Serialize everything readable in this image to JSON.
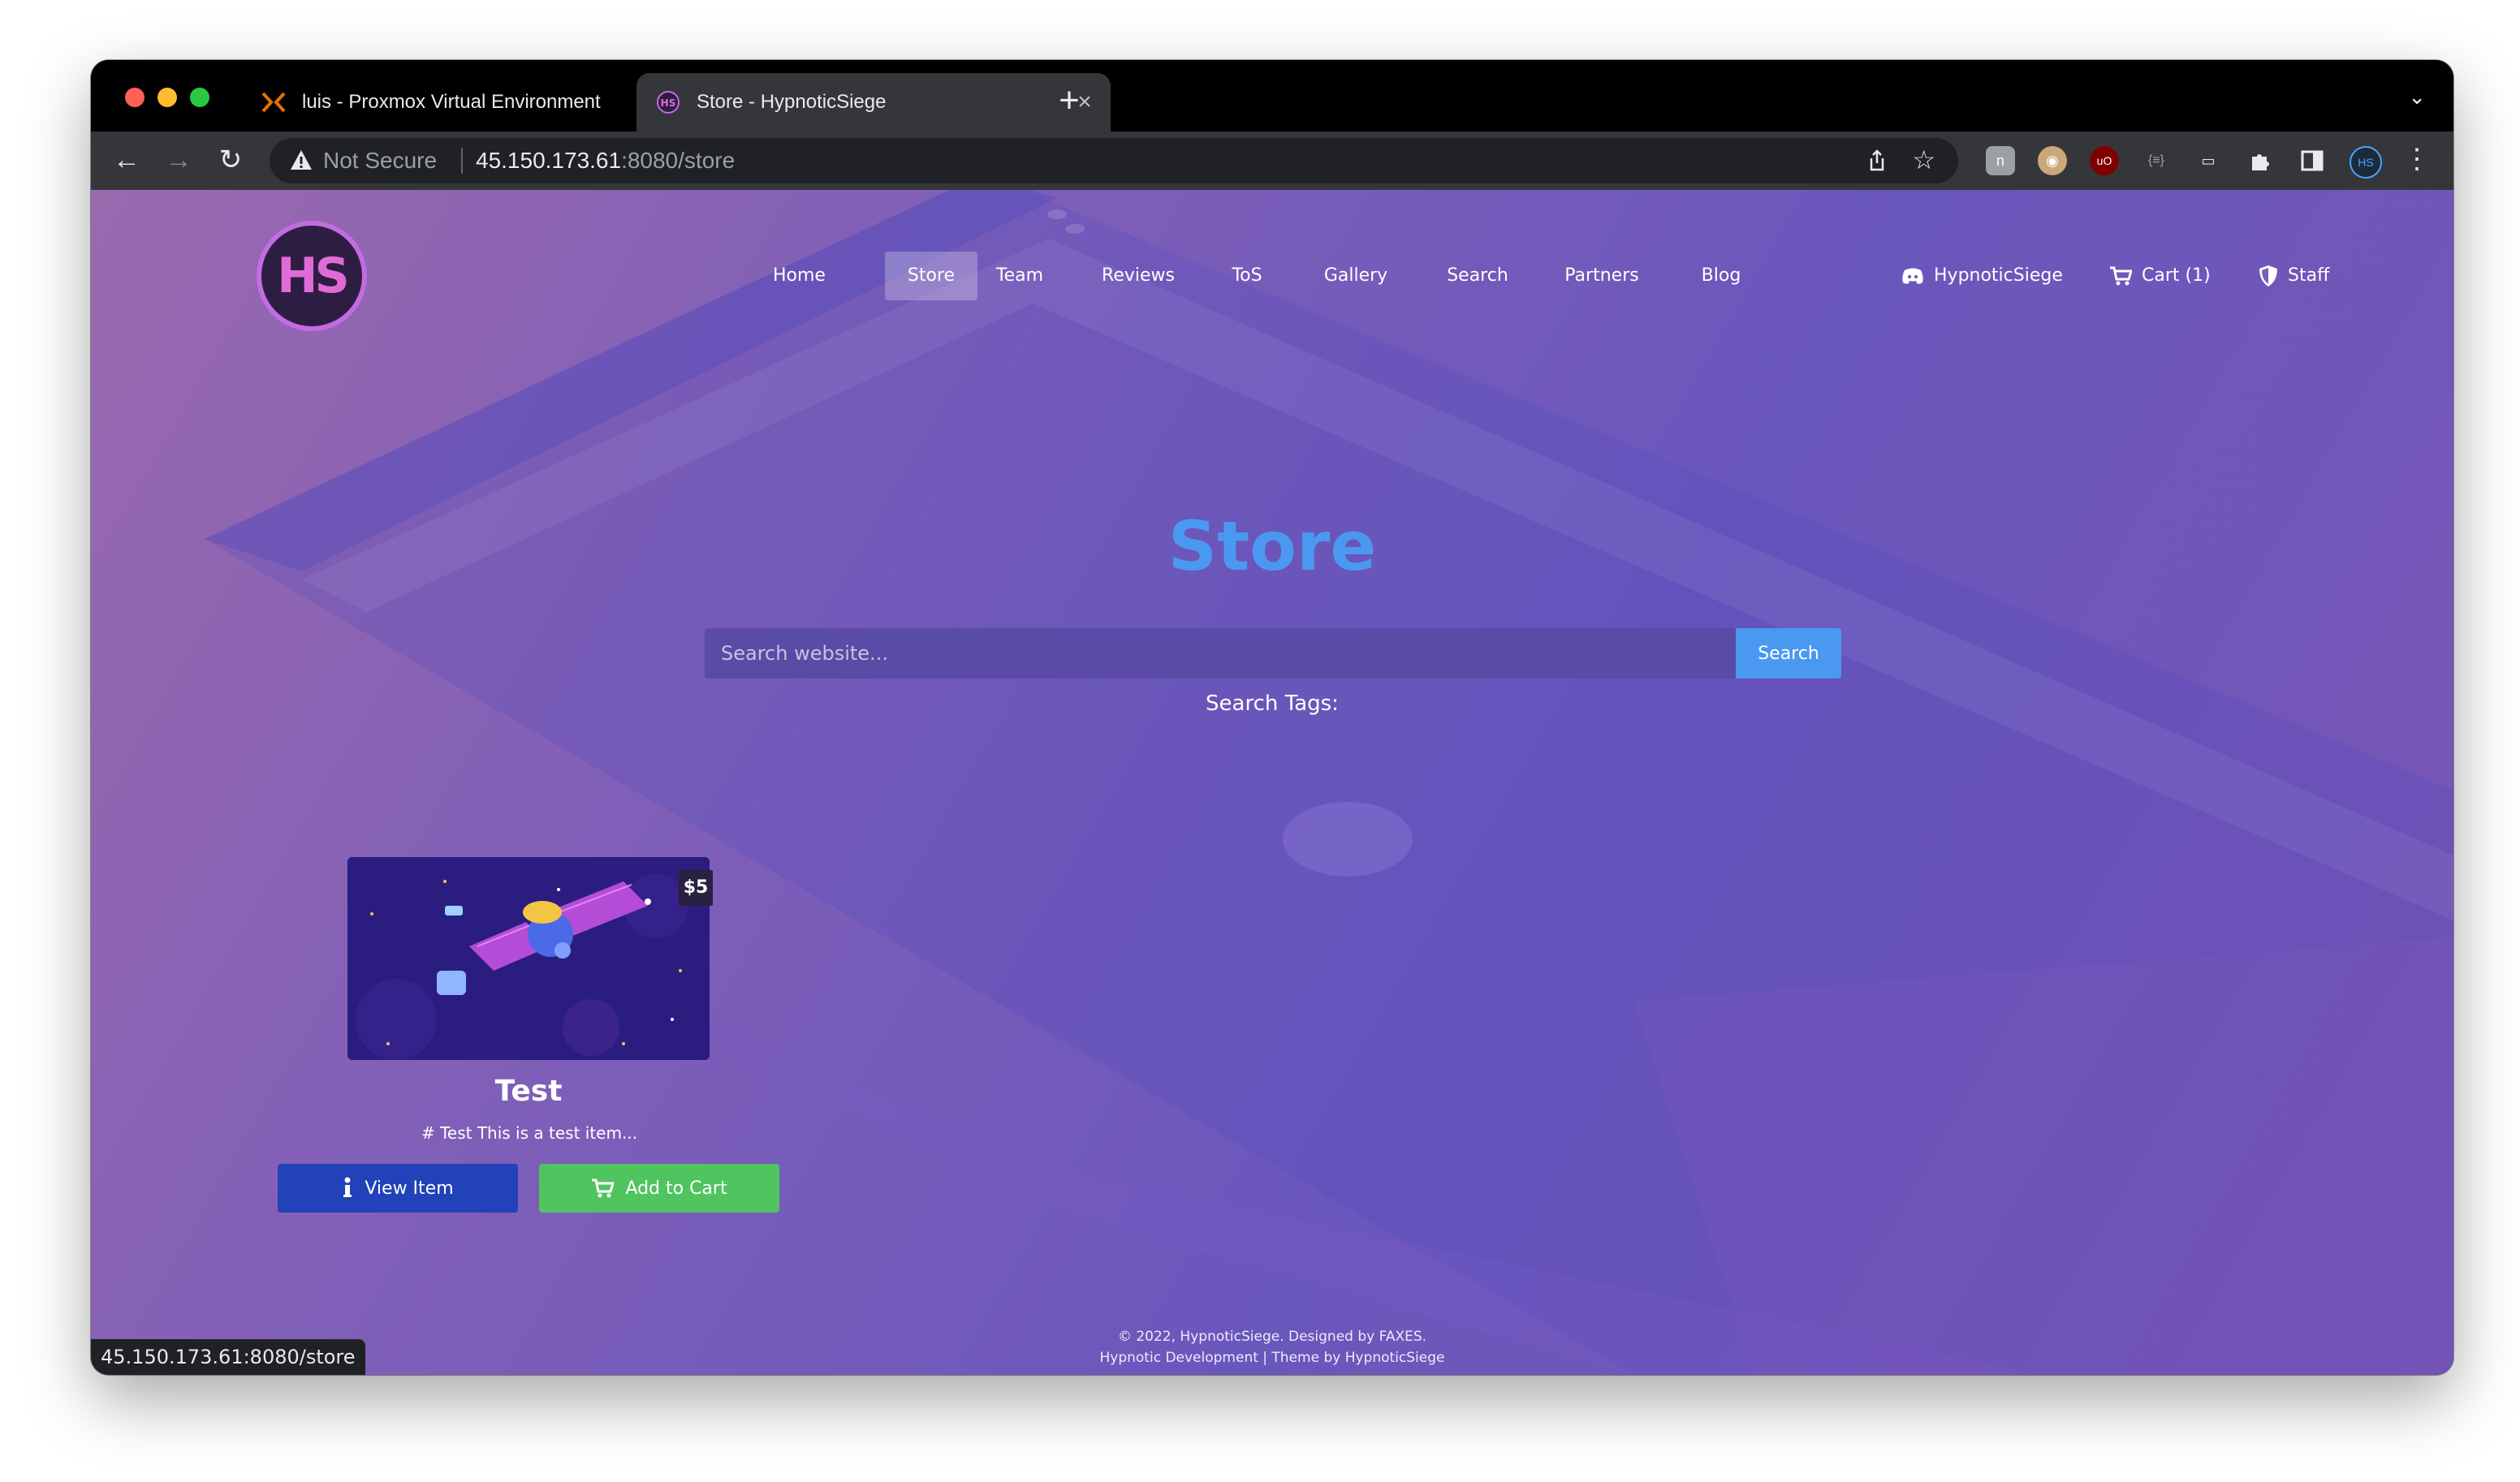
{
  "browser": {
    "tabs": [
      {
        "title": "luis - Proxmox Virtual Environment",
        "icon": "proxmox-icon",
        "active": false
      },
      {
        "title": "Store - HypnoticSiege",
        "icon": "hypnoticsiege-icon",
        "active": true
      }
    ],
    "new_tab_label": "+",
    "address": {
      "security_label": "Not Secure",
      "host": "45.150.173.61",
      "path": ":8080/store"
    },
    "status_url": "45.150.173.61:8080/store"
  },
  "site": {
    "logo_text": "HS",
    "nav": [
      "Home",
      "Store",
      "Team",
      "Reviews",
      "ToS",
      "Gallery",
      "Search",
      "Partners",
      "Blog"
    ],
    "active_nav": "Store",
    "discord_label": "HypnoticSiege",
    "cart_label": "Cart (1)",
    "staff_label": "Staff"
  },
  "main": {
    "title": "Store",
    "search_placeholder": "Search website...",
    "search_button": "Search",
    "search_tags_label": "Search Tags:"
  },
  "items": [
    {
      "name": "Test",
      "price": "$5",
      "description": "# Test This is a test item...",
      "view_label": "View Item",
      "add_label": "Add to Cart"
    }
  ],
  "footer": {
    "line1": "© 2022, HypnoticSiege. Designed by FAXES.",
    "line2": "Hypnotic Development | Theme by HypnoticSiege"
  },
  "colors": {
    "accent": "#4a98f0",
    "view_button": "#2142b8",
    "cart_button": "#4fc45f",
    "logo_ring": "#c26ce0"
  }
}
